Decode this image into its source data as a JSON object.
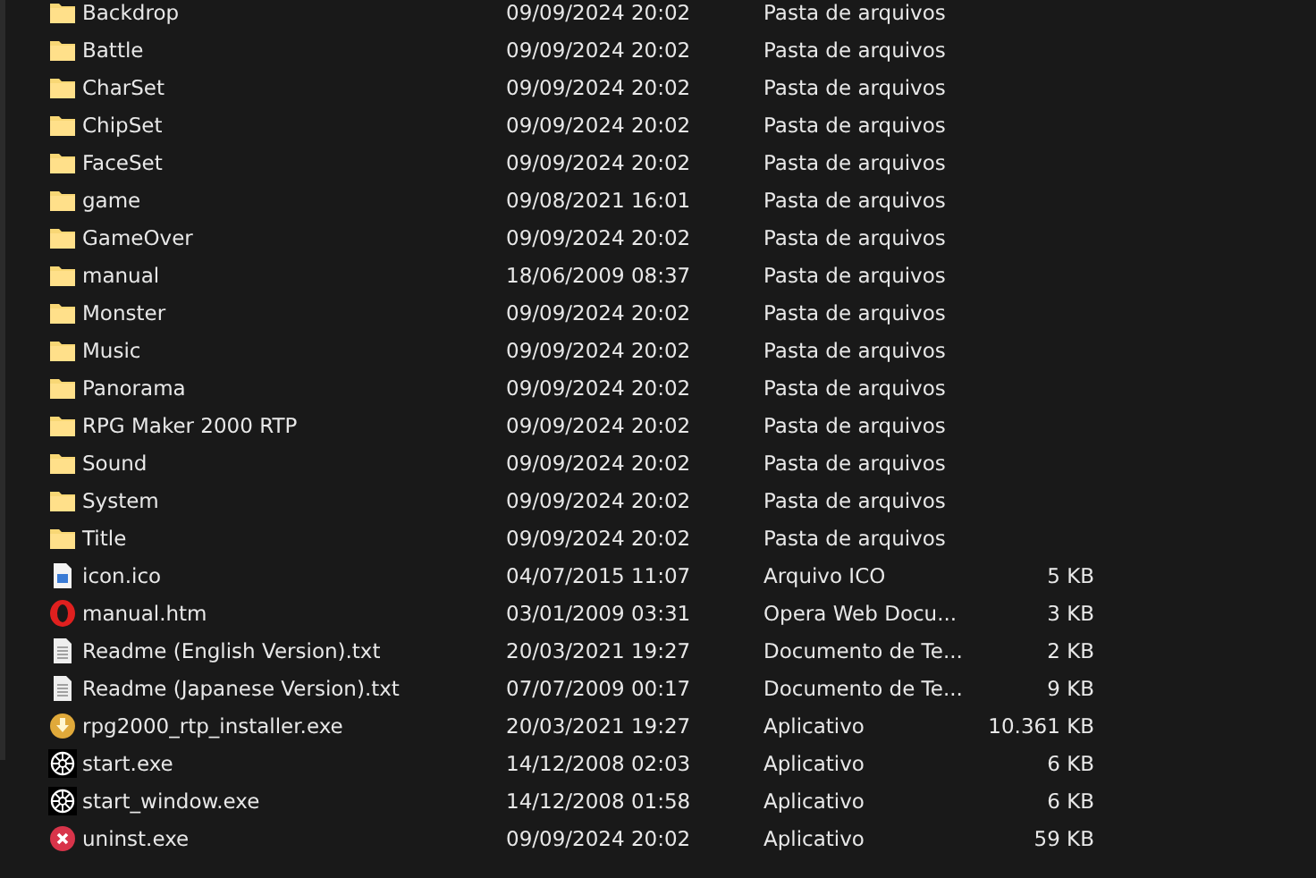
{
  "files": [
    {
      "kind": "folder",
      "name": "Backdrop",
      "date": "09/09/2024 20:02",
      "type": "Pasta de arquivos"
    },
    {
      "kind": "folder",
      "name": "Battle",
      "date": "09/09/2024 20:02",
      "type": "Pasta de arquivos"
    },
    {
      "kind": "folder",
      "name": "CharSet",
      "date": "09/09/2024 20:02",
      "type": "Pasta de arquivos"
    },
    {
      "kind": "folder",
      "name": "ChipSet",
      "date": "09/09/2024 20:02",
      "type": "Pasta de arquivos"
    },
    {
      "kind": "folder",
      "name": "FaceSet",
      "date": "09/09/2024 20:02",
      "type": "Pasta de arquivos"
    },
    {
      "kind": "folder",
      "name": "game",
      "date": "09/08/2021 16:01",
      "type": "Pasta de arquivos"
    },
    {
      "kind": "folder",
      "name": "GameOver",
      "date": "09/09/2024 20:02",
      "type": "Pasta de arquivos"
    },
    {
      "kind": "folder",
      "name": "manual",
      "date": "18/06/2009 08:37",
      "type": "Pasta de arquivos"
    },
    {
      "kind": "folder",
      "name": "Monster",
      "date": "09/09/2024 20:02",
      "type": "Pasta de arquivos"
    },
    {
      "kind": "folder",
      "name": "Music",
      "date": "09/09/2024 20:02",
      "type": "Pasta de arquivos"
    },
    {
      "kind": "folder",
      "name": "Panorama",
      "date": "09/09/2024 20:02",
      "type": "Pasta de arquivos"
    },
    {
      "kind": "folder",
      "name": "RPG Maker 2000 RTP",
      "date": "09/09/2024 20:02",
      "type": "Pasta de arquivos"
    },
    {
      "kind": "folder",
      "name": "Sound",
      "date": "09/09/2024 20:02",
      "type": "Pasta de arquivos"
    },
    {
      "kind": "folder",
      "name": "System",
      "date": "09/09/2024 20:02",
      "type": "Pasta de arquivos"
    },
    {
      "kind": "folder",
      "name": "Title",
      "date": "09/09/2024 20:02",
      "type": "Pasta de arquivos"
    },
    {
      "kind": "image",
      "name": "icon.ico",
      "date": "04/07/2015 11:07",
      "type": "Arquivo ICO",
      "size": "5 KB"
    },
    {
      "kind": "web",
      "name": "manual.htm",
      "date": "03/01/2009 03:31",
      "type": "Opera Web Docu...",
      "size": "3 KB"
    },
    {
      "kind": "text",
      "name": "Readme (English Version).txt",
      "date": "20/03/2021 19:27",
      "type": "Documento de Te...",
      "size": "2 KB"
    },
    {
      "kind": "text",
      "name": "Readme (Japanese Version).txt",
      "date": "07/07/2009 00:17",
      "type": "Documento de Te...",
      "size": "9 KB"
    },
    {
      "kind": "installer",
      "name": "rpg2000_rtp_installer.exe",
      "date": "20/03/2021 19:27",
      "type": "Aplicativo",
      "size": "10.361 KB"
    },
    {
      "kind": "app",
      "name": "start.exe",
      "date": "14/12/2008 02:03",
      "type": "Aplicativo",
      "size": "6 KB"
    },
    {
      "kind": "app",
      "name": "start_window.exe",
      "date": "14/12/2008 01:58",
      "type": "Aplicativo",
      "size": "6 KB"
    },
    {
      "kind": "uninstaller",
      "name": "uninst.exe",
      "date": "09/09/2024 20:02",
      "type": "Aplicativo",
      "size": "59 KB"
    }
  ]
}
